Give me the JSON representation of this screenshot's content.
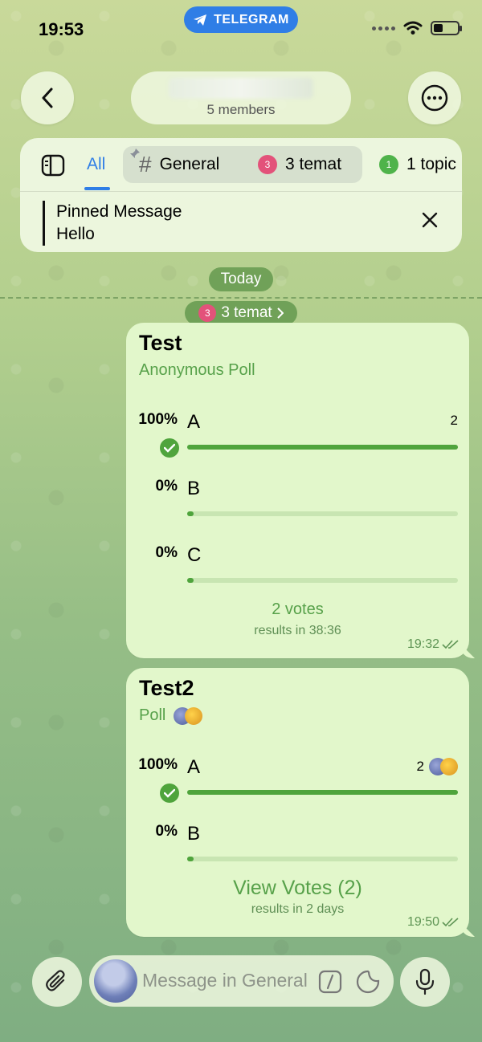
{
  "status_bar": {
    "time": "19:53",
    "app_pill": "TELEGRAM"
  },
  "header": {
    "members": "5 members",
    "back_icon": "chevron-left-icon",
    "more_icon": "ellipsis-icon"
  },
  "topics_bar": {
    "tabs": [
      {
        "label": "All",
        "selected": true
      },
      {
        "label": "General",
        "pinned": true,
        "icon": "hash-icon"
      },
      {
        "label": "3 temat",
        "badge": "3",
        "badge_color": "#e3527a"
      },
      {
        "label": "1 topic",
        "badge": "1",
        "badge_color": "#4fb34a"
      }
    ],
    "pinned_message": {
      "title": "Pinned Message",
      "text": "Hello"
    }
  },
  "chat": {
    "date_separator": "Today",
    "topic_label": {
      "badge": "3",
      "text": "3 temat"
    },
    "messages": [
      {
        "title": "Test",
        "poll_type": "Anonymous Poll",
        "options": [
          {
            "percent": "100%",
            "label": "A",
            "fill": 1.0,
            "count": "2",
            "checked": true
          },
          {
            "percent": "0%",
            "label": "B",
            "fill": 0.0
          },
          {
            "percent": "0%",
            "label": "C",
            "fill": 0.0
          }
        ],
        "votes": "2 votes",
        "results": "results in 38:36",
        "time": "19:32"
      },
      {
        "title": "Test2",
        "poll_type": "Poll",
        "options": [
          {
            "percent": "100%",
            "label": "A",
            "fill": 1.0,
            "count": "2",
            "checked": true
          },
          {
            "percent": "0%",
            "label": "B",
            "fill": 0.0
          }
        ],
        "votes": "View Votes (2)",
        "results": "results in 2 days",
        "time": "19:50"
      }
    ]
  },
  "composer": {
    "placeholder": "Message in General"
  },
  "colors": {
    "accent": "#2f7ee6",
    "poll_green": "#4fa43c",
    "bubble": "#e2f7cb"
  }
}
